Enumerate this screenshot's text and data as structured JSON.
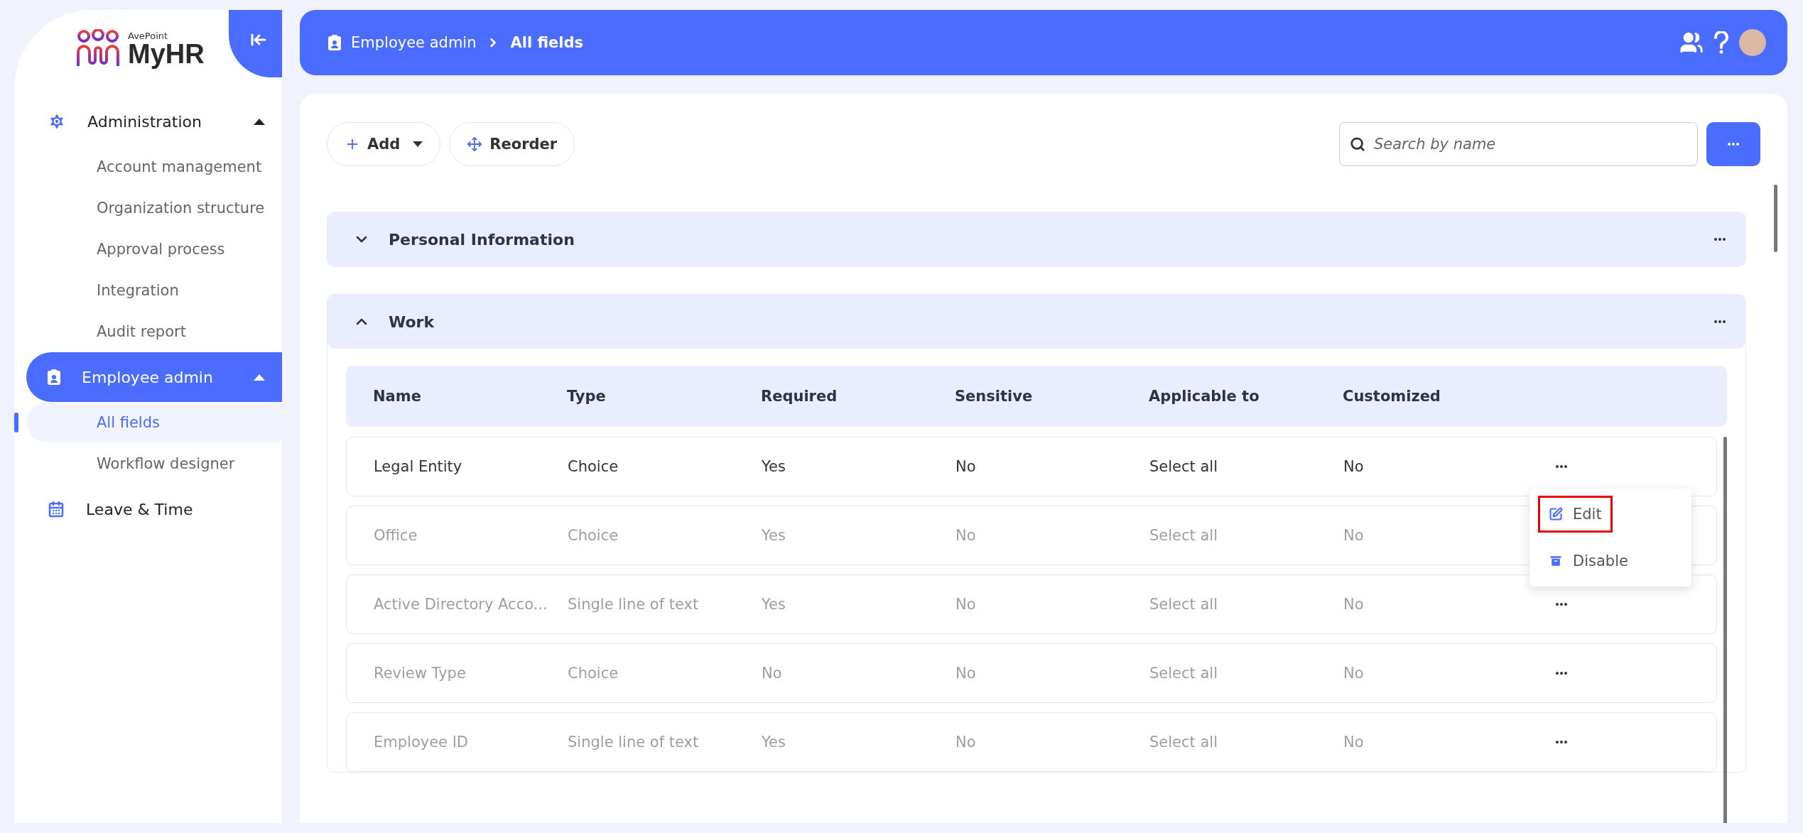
{
  "brand": {
    "company": "AvePoint",
    "product": "MyHR"
  },
  "sidebar": {
    "sections": [
      {
        "label": "Administration",
        "expanded": true,
        "selected": false,
        "children": [
          {
            "label": "Account management",
            "selected": false
          },
          {
            "label": "Organization structure",
            "selected": false
          },
          {
            "label": "Approval process",
            "selected": false
          },
          {
            "label": "Integration",
            "selected": false
          },
          {
            "label": "Audit report",
            "selected": false
          }
        ]
      },
      {
        "label": "Employee admin",
        "expanded": true,
        "selected": true,
        "children": [
          {
            "label": "All fields",
            "selected": true
          },
          {
            "label": "Workflow designer",
            "selected": false
          }
        ]
      },
      {
        "label": "Leave & Time",
        "expanded": false,
        "selected": false
      }
    ]
  },
  "breadcrumb": [
    "Employee admin",
    "All fields"
  ],
  "toolbar": {
    "buttons": [
      {
        "label": "Add",
        "kind": "add"
      },
      {
        "label": "Reorder",
        "kind": "reorder"
      }
    ],
    "search": {
      "placeholder": "Search by name"
    }
  },
  "groups": [
    {
      "title": "Personal Information",
      "expanded": false
    },
    {
      "title": "Work",
      "expanded": true
    }
  ],
  "table": {
    "columns": [
      "Name",
      "Type",
      "Required",
      "Sensitive",
      "Applicable to",
      "Customized"
    ],
    "rows": [
      {
        "cells": [
          "Legal Entity",
          "Choice",
          "Yes",
          "No",
          "Select all",
          "No"
        ],
        "blurred": false
      },
      {
        "cells": [
          "Office",
          "Choice",
          "Yes",
          "No",
          "Select all",
          "No"
        ],
        "blurred": true
      },
      {
        "cells": [
          "Active Directory Acco...",
          "Single line of text",
          "Yes",
          "No",
          "Select all",
          "No"
        ],
        "blurred": true
      },
      {
        "cells": [
          "Review Type",
          "Choice",
          "No",
          "No",
          "Select all",
          "No"
        ],
        "blurred": true
      },
      {
        "cells": [
          "Employee ID",
          "Single line of text",
          "Yes",
          "No",
          "Select all",
          "No"
        ],
        "blurred": true
      }
    ]
  },
  "row_menu": {
    "items": [
      {
        "label": "Edit",
        "kind": "edit",
        "highlighted": true
      },
      {
        "label": "Disable",
        "kind": "disable",
        "highlighted": false
      }
    ]
  }
}
